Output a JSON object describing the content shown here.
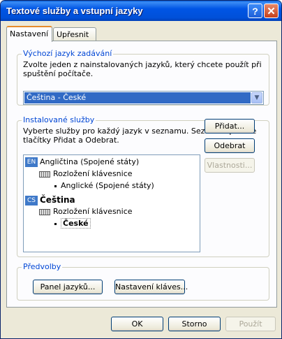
{
  "window": {
    "title": "Textové služby a vstupní jazyky",
    "help_glyph": "?",
    "close_glyph": "✕"
  },
  "tabs": [
    {
      "label": "Nastavení",
      "active": true
    },
    {
      "label": "Upřesnit",
      "active": false
    }
  ],
  "default_language": {
    "legend": "Výchozí jazyk zadávání",
    "description": "Zvolte jeden z nainstalovaných jazyků, který chcete použít při spuštění počítače.",
    "selected": "Čeština - České"
  },
  "installed": {
    "legend": "Instalované služby",
    "description": "Vyberte služby pro každý jazyk v seznamu. Seznam upravíte tlačítky Přidat a Odebrat.",
    "tree": [
      {
        "badge": "EN",
        "label": "Angličtina (Spojené státy)"
      },
      {
        "label": "Rozložení klávesnice"
      },
      {
        "label": "Anglické (Spojené státy)"
      },
      {
        "badge": "CS",
        "label": "Čeština"
      },
      {
        "label": "Rozložení klávesnice"
      },
      {
        "label": "České"
      }
    ],
    "buttons": {
      "add": "Přidat...",
      "remove": "Odebrat",
      "properties": "Vlastnosti..."
    }
  },
  "preferences": {
    "legend": "Předvolby",
    "language_bar": "Panel jazyků...",
    "key_settings": "Nastavení kláves..."
  },
  "footer": {
    "ok": "OK",
    "cancel": "Storno",
    "apply": "Použít"
  },
  "colors": {
    "title_bar": "#0055e5",
    "selection": "#316ac5",
    "group_legend": "#0046d5",
    "active_tab_accent": "#e68b2c"
  }
}
